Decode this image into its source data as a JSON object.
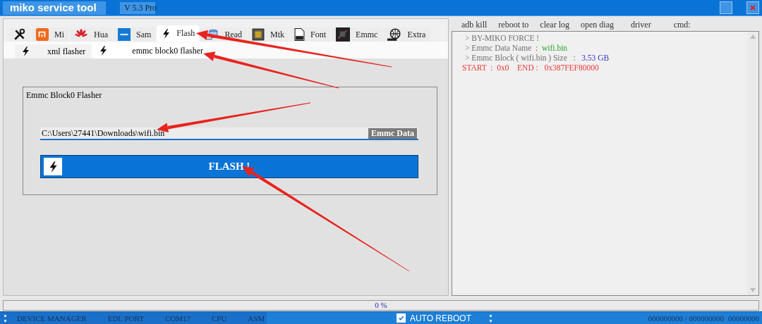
{
  "window": {
    "title": "miko service tool",
    "version": "V 5.3 Pro"
  },
  "tabs": [
    {
      "selected": false
    },
    {
      "label": "Mi",
      "selected": false
    },
    {
      "label": "Hua",
      "selected": false
    },
    {
      "label": "Sam",
      "selected": false
    },
    {
      "label": "Flash",
      "selected": true
    },
    {
      "label": "Read",
      "selected": false
    },
    {
      "label": "Mtk",
      "selected": false
    },
    {
      "label": "Font",
      "selected": false
    },
    {
      "label": "Emmc",
      "selected": false
    },
    {
      "label": "Extra",
      "selected": false
    }
  ],
  "subtabs": [
    {
      "label": "xml flasher",
      "selected": false
    },
    {
      "label": "emmc block0 flasher",
      "selected": true
    }
  ],
  "flasher": {
    "title": "Emmc Block0 Flasher",
    "file_path": "C:\\Users\\27441\\Downloads\\wifi.bin",
    "file_button": "Emmc Data",
    "flash_button": "FLASH !"
  },
  "toolbar": [
    "adb kill",
    "reboot to",
    "clear log",
    "open diag",
    "driver",
    "cmd:"
  ],
  "log": [
    {
      "parts": [
        {
          "text": "> BY-MIKO FORCE !",
          "color": "#707070"
        }
      ]
    },
    {
      "parts": [
        {
          "text": "> Emmc Data Name  :  ",
          "color": "#707070"
        },
        {
          "text": "wifi.bin",
          "color": "#2aa52a"
        }
      ]
    },
    {
      "parts": [
        {
          "text": "> Emmc Block ( wifi.bin ) Size   :   ",
          "color": "#707070"
        },
        {
          "text": "3.53 GB",
          "color": "#3535c8"
        }
      ]
    },
    {
      "parts": [
        {
          "text": "START  :  0x0    END :   0x387FEF80000",
          "color": "#e83a3a"
        }
      ]
    }
  ],
  "progress": {
    "level": 0,
    "reading": "0 %"
  },
  "status_bar": {
    "fields": [
      "DEVICE MANAGER",
      "EDL PORT",
      "COM17",
      "CPU",
      "ASM"
    ],
    "auto_reboot": {
      "label": "AUTO REBOOT",
      "checked": true
    },
    "counter": "000000000 / 000000000",
    "counter_2": "00000000"
  }
}
